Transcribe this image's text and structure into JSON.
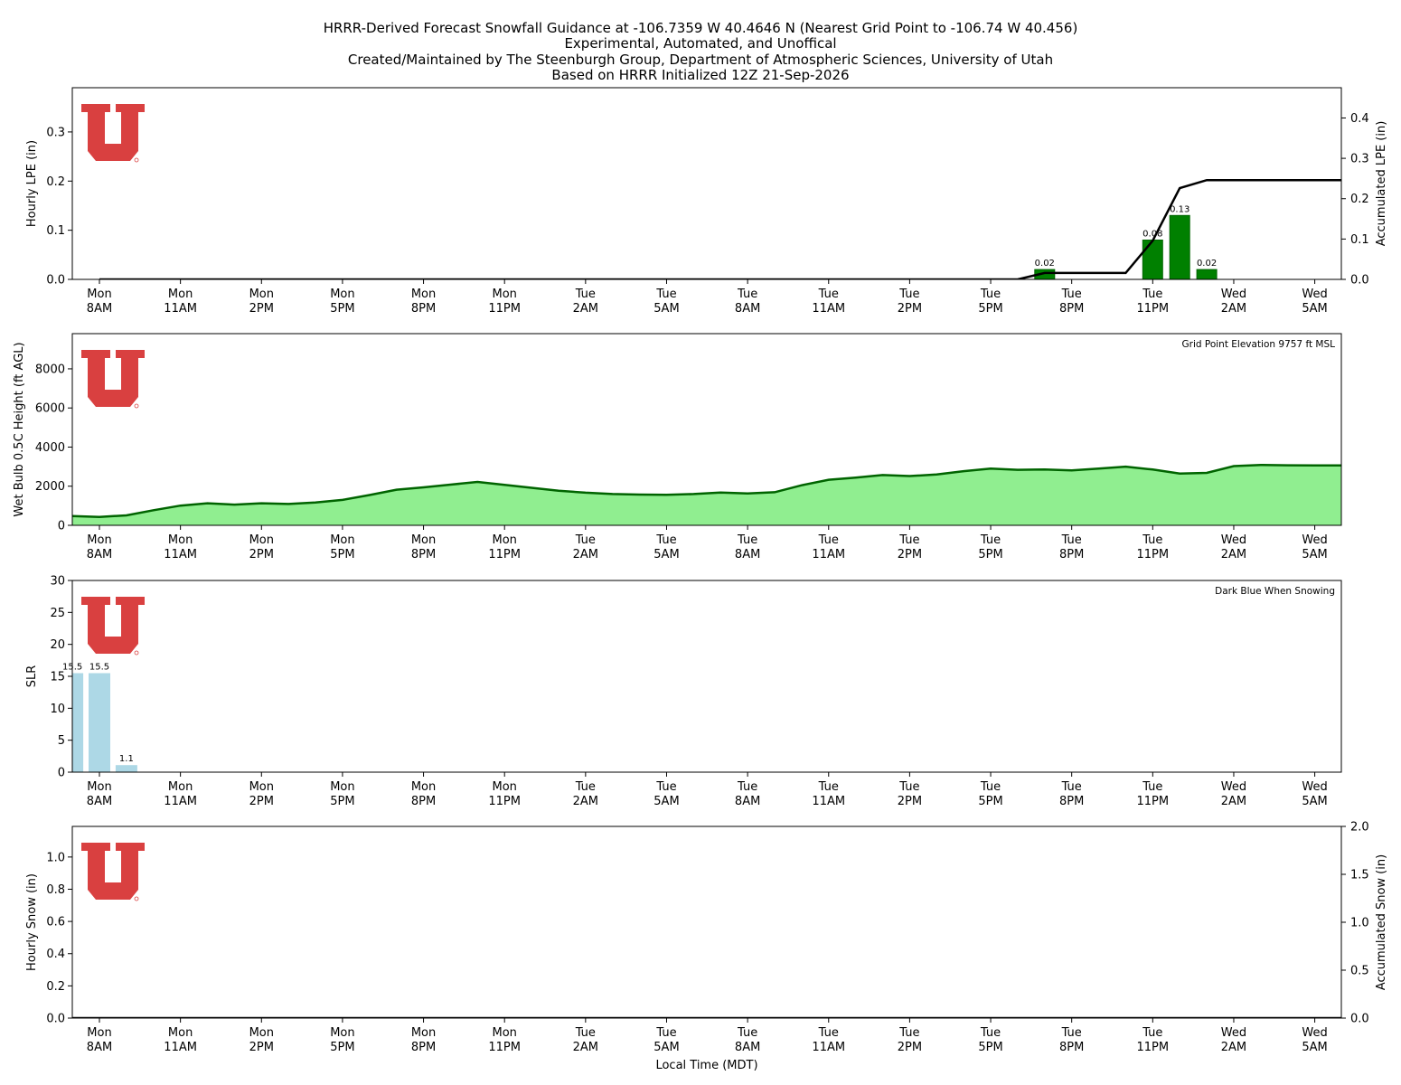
{
  "titles": [
    "HRRR-Derived Forecast Snowfall Guidance at -106.7359 W 40.4646 N (Nearest Grid Point to -106.74 W 40.456)",
    "Experimental, Automated, and Unoffical",
    "Created/Maintained by The Steenburgh Group, Department of Atmospheric Sciences, University of Utah",
    "Based on HRRR Initialized 12Z 21-Sep-2026"
  ],
  "x_tick_labels": [
    [
      "Mon",
      "8AM"
    ],
    [
      "Mon",
      "11AM"
    ],
    [
      "Mon",
      "2PM"
    ],
    [
      "Mon",
      "5PM"
    ],
    [
      "Mon",
      "8PM"
    ],
    [
      "Mon",
      "11PM"
    ],
    [
      "Tue",
      "2AM"
    ],
    [
      "Tue",
      "5AM"
    ],
    [
      "Tue",
      "8AM"
    ],
    [
      "Tue",
      "11AM"
    ],
    [
      "Tue",
      "2PM"
    ],
    [
      "Tue",
      "5PM"
    ],
    [
      "Tue",
      "8PM"
    ],
    [
      "Tue",
      "11PM"
    ],
    [
      "Wed",
      "2AM"
    ],
    [
      "Wed",
      "5AM"
    ]
  ],
  "x_axis_label": "Local Time (MDT)",
  "colors": {
    "lpe_bar": "#008000",
    "lpe_bar_edge": "#006400",
    "accum_line": "#000000",
    "wetbulb_fill": "#90ee90",
    "wetbulb_line": "#006400",
    "slr_bar": "#add8e6",
    "logo": "#cc0000"
  },
  "chart_data": [
    {
      "name_id": "hourly-lpe",
      "type": "bar",
      "ylabel": "Hourly LPE (in)",
      "ylabel_right": "Accumulated LPE (in)",
      "x_hours": [
        0,
        1,
        2,
        3,
        4,
        5,
        6,
        7,
        8,
        9,
        10,
        11,
        12,
        13,
        14,
        15,
        16,
        17,
        18,
        19,
        20,
        21,
        22,
        23,
        24,
        25,
        26,
        27,
        28,
        29,
        30,
        31,
        32,
        33,
        34,
        35,
        36,
        37,
        38,
        39,
        40,
        41,
        42,
        43,
        44,
        45,
        46
      ],
      "ylim": [
        0,
        0.39
      ],
      "yticks": [
        0.0,
        0.1,
        0.2,
        0.3
      ],
      "ylim_right": [
        0,
        0.475
      ],
      "yticks_right": [
        0.0,
        0.1,
        0.2,
        0.3,
        0.4
      ],
      "bars": [
        {
          "x": 35,
          "value": 0.02,
          "label": "0.02"
        },
        {
          "x": 39,
          "value": 0.08,
          "label": "0.08"
        },
        {
          "x": 40,
          "value": 0.13,
          "label": "0.13"
        },
        {
          "x": 41,
          "value": 0.02,
          "label": "0.02"
        }
      ],
      "accumulated_x": [
        0,
        34,
        35,
        36,
        37,
        38,
        39,
        40,
        41,
        42,
        43,
        44,
        45,
        46,
        47
      ],
      "accumulated": [
        0,
        0,
        0.016,
        0.016,
        0.016,
        0.016,
        0.096,
        0.226,
        0.246,
        0.246,
        0.246,
        0.246,
        0.246,
        0.246,
        0.246
      ]
    },
    {
      "name_id": "wetbulb-height",
      "type": "area",
      "ylabel": "Wet Bulb 0.5C Height (ft AGL)",
      "annotation": "Grid Point Elevation 9757 ft MSL",
      "ylim": [
        0,
        9800
      ],
      "yticks": [
        0,
        2000,
        4000,
        6000,
        8000
      ],
      "x": [
        -1,
        0,
        1,
        2,
        3,
        4,
        5,
        6,
        7,
        8,
        9,
        10,
        11,
        12,
        13,
        14,
        15,
        16,
        17,
        18,
        19,
        20,
        21,
        22,
        23,
        24,
        25,
        26,
        27,
        28,
        29,
        30,
        31,
        32,
        33,
        34,
        35,
        36,
        37,
        38,
        39,
        40,
        41,
        42,
        43,
        44,
        45,
        46,
        47
      ],
      "values": [
        470,
        430,
        510,
        770,
        1010,
        1130,
        1060,
        1130,
        1090,
        1170,
        1300,
        1550,
        1820,
        1940,
        2080,
        2220,
        2070,
        1920,
        1770,
        1670,
        1600,
        1570,
        1560,
        1600,
        1680,
        1630,
        1690,
        2050,
        2330,
        2440,
        2570,
        2520,
        2600,
        2770,
        2900,
        2840,
        2850,
        2810,
        2900,
        3000,
        2850,
        2650,
        2680,
        3030,
        3090,
        3070,
        3060,
        3060,
        3060
      ]
    },
    {
      "name_id": "slr",
      "type": "bar",
      "ylabel": "SLR",
      "annotation": "Dark Blue When Snowing",
      "ylim": [
        0,
        30
      ],
      "yticks": [
        0,
        5,
        10,
        15,
        20,
        25,
        30
      ],
      "bars": [
        {
          "x": -1,
          "value": 15.5,
          "label": "15.5"
        },
        {
          "x": 0,
          "value": 15.5,
          "label": "15.5"
        },
        {
          "x": 1,
          "value": 1.1,
          "label": "1.1"
        }
      ]
    },
    {
      "name_id": "hourly-snow",
      "type": "bar",
      "ylabel": "Hourly Snow (in)",
      "ylabel_right": "Accumulated Snow (in)",
      "ylim": [
        0,
        1.19
      ],
      "yticks": [
        0.0,
        0.2,
        0.4,
        0.6,
        0.8,
        1.0
      ],
      "ylim_right": [
        0,
        2.0
      ],
      "yticks_right": [
        0.0,
        0.5,
        1.0,
        1.5,
        2.0
      ],
      "bars": [],
      "accumulated_x": [
        -1,
        47
      ],
      "accumulated": [
        0,
        0
      ]
    }
  ]
}
